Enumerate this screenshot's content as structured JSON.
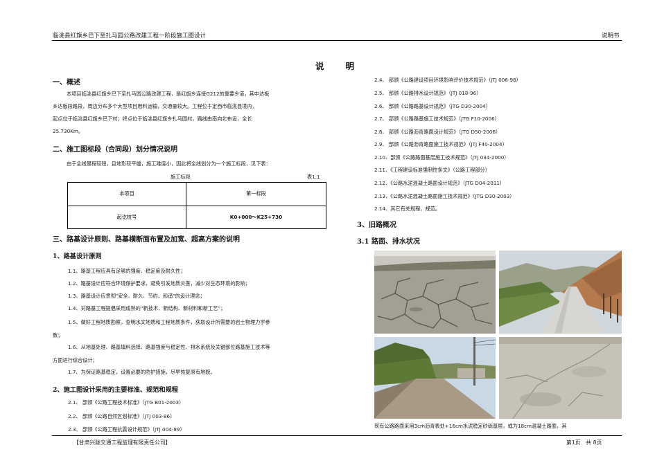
{
  "header": {
    "title": "临洮县红旗乡巴下至扎马园公路改建工程一阶段施工图设计",
    "doc_type": "说明书"
  },
  "page_title": "说　　明",
  "sec1": {
    "heading": "一、概述",
    "lines": [
      "本项目临洮县红旗乡巴下至扎马园公路改建工程，是红旗乡连接G212的重要乡道，其中达板",
      "乡达板段路段，周边分布多个大型项目用料运输，交通量较大。工程位于定西市临洮县境内，",
      "起点位于临洮县红旗乡巴下村；终点位于临洮县红旗乡扎马园村，路线由南向北布设，全长",
      "25.730Km。"
    ]
  },
  "sec2": {
    "heading": "二、施工图标段（合同段）划分情况说明",
    "intro": "由于全线里程较短，且地形较平缓，施工难度小，因此将全线划分为一个施工标段，见下表：",
    "table_caption": "施工标段",
    "table_no": "表1.1",
    "table": {
      "r1": [
        "本项目",
        "第一标段"
      ],
      "r2": [
        "起讫桩号",
        "K0+000～K25+730"
      ]
    }
  },
  "sec3": {
    "heading": "三、路基设计原则、路基横断面布置及加宽、超高方案的说明",
    "sub1": "1、路基设计原则",
    "items": [
      "1.1、路基工程应具有足够的强度、稳定度及耐久性；",
      "1.2、路基设计应符合环境保护要求，避免引发地质灾害，减少对生态环境的影响；",
      "1.3、路基设计应贯彻\"安全、耐久、节约、和谐\"的设计理念；",
      "1.4、对路基工程提倡采用成熟的“新技术、新结构、新材料和新工艺”；",
      "1.5、做好工程地质勘察，查明水文地质和工程地质条件，获取设计所需要的岩土物理力学参",
      "数；",
      "1.6、从地基处理、路基填料选择、路基强度与稳定性、排水系统及关键部位路基施工技术等",
      "方面进行综合设计；",
      "1.7、为保证路基稳定，设置必要的防护措施，尽早恢复原有地貌。"
    ],
    "sub2": "2、施工图设计采用的主要标准、规范和规程",
    "norms": [
      "2.1、 部颁《公路工程技术标准》（JTG B01-2003）",
      "2.2、 部颁《公路自然区划标准》（JTJ 003-86）",
      "2.3、 部颁《公路工程抗震设计规范》（JTJ 004-89）"
    ]
  },
  "right": {
    "norms": [
      "2.4、 部颁《公路建设项目环境影响评价技术规范》（JTJ 006-98）",
      "2.5、 部颁《公路排水设计规范》（JTJ 018-96）",
      "2.6、 部颁《公路路基设计规范》（JTG D30-2004）",
      "2.7、 部颁《公路路基施工技术规范》（JTG F10-2006）",
      "2.8、 部颁《公路沥青路面设计规范》（JTG D50-2006）",
      "2.9、 部颁《公路沥青路面施工技术规范》（JTJ F40-2004）",
      "2.10、部颁《公路路面基层施工技术规范》（JTJ 034-2000）",
      "2.11、《工程建设标准强制性条文》（公路工程部分）",
      "2.12、《公路水泥混凝土路面设计规范》（JTG D04-2011）",
      "2.13、《公路水泥混凝土路面施工技术规范》（JTG D30-2003）",
      "2.14、其它有关规程、规范。"
    ],
    "sec3_heading": "3、旧路概况",
    "sec31_heading": "3.1 路面、排水状况",
    "caption": "现有公路路面采用3cm沥青表处+16cm水泥稳定砂砾基层，或为18cm混凝土路面，其"
  },
  "footer": {
    "company": "【甘肃兴陇交通工程监理有限责任公司】",
    "page": "第1页　共 8页"
  },
  "photos": [
    "cracked-pavement-photo",
    "concrete-road-photo",
    "village-road-photo",
    "road-surface-closeup-photo"
  ]
}
